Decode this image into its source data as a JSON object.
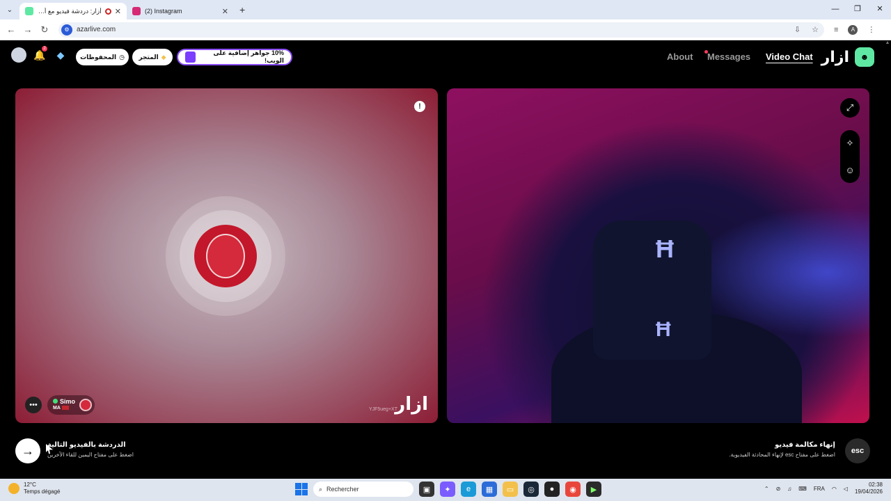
{
  "browser": {
    "tabs": [
      {
        "title": "أزار: دردشة فيديو مع أشخاص",
        "favicon_color": "#5fe8a3",
        "active": true
      },
      {
        "title": "(2) Instagram",
        "favicon_color": "#d62976",
        "active": false
      }
    ],
    "url": "azarlive.com",
    "profile_initial": "A"
  },
  "header": {
    "saved_label": "المحفوظات",
    "store_label": "المتجر",
    "promo_label": "10% جواهر إضافية على الويب!",
    "nav": {
      "about": "About",
      "messages": "Messages",
      "video_chat": "Video Chat"
    },
    "brand": "ازار",
    "notif_count": "2"
  },
  "peer": {
    "name": "Simo",
    "country": "MA",
    "id": "YJF5ueg+XT",
    "watermark": "ازار"
  },
  "controls": {
    "next_title": "الدردشة بالفيديو التالية",
    "next_sub": "اضغط على مفتاح اليمين للقاء الآخرين",
    "end_title": "إنهاء مكالمة فيديو",
    "end_sub": "اضغط على مفتاح esc لإنهاء المحادثة الفيديوية.",
    "esc_label": "esc"
  },
  "taskbar": {
    "temperature": "12°C",
    "weather": "Temps dégagé",
    "search_placeholder": "Rechercher",
    "language": "FRA",
    "time": "02:38",
    "date": "19/04/2026"
  },
  "colors": {
    "accent_green": "#5fe8a3",
    "promo_purple": "#8a4dff"
  }
}
